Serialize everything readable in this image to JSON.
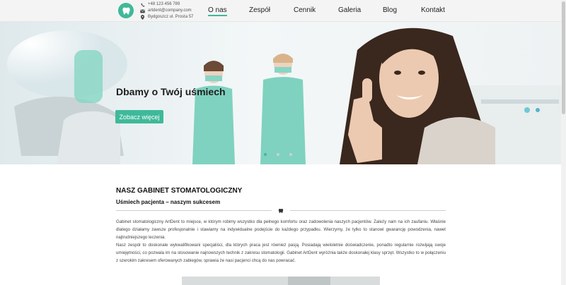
{
  "header": {
    "phone": "+48 123 456 789",
    "email": "artdent@company.com",
    "address": "Bydgoszcz ul. Prosta 57"
  },
  "nav": {
    "items": [
      {
        "label": "O nas"
      },
      {
        "label": "Zespół"
      },
      {
        "label": "Cennik"
      },
      {
        "label": "Galeria"
      },
      {
        "label": "Blog"
      },
      {
        "label": "Kontakt"
      }
    ],
    "active": "O nas"
  },
  "hero": {
    "title": "Dbamy o Twój uśmiech",
    "button": "Zobacz więcej",
    "slides_total": 3,
    "slide_active": 1
  },
  "about": {
    "title": "NASZ GABINET STOMATOLOGICZNY",
    "subtitle": "Uśmiech pacjenta – naszym sukcesem",
    "paragraph1": "Gabinet stomatologiczny ArtDent to miejsce, w którym robimy wszystko dla pełnego komfortu oraz zadowolenia naszych pacjentów. Zależy nam na ich zaufaniu. Właśnie dlatego działamy zawsze profesjonalnie i stawiamy na indywidualne podejście do każdego przypadku. Wierzymy, że tylko to stanowi gwarancję powodzenia, nawet najtrudniejszego leczenia.",
    "paragraph2": "Nasz zespół to doskonale wykwalifikowani specjaliści, dla których praca jest również pasją. Posiadają wieloletnie doświadczenie, ponadto regularnie rozwijają swoje umiejętności, co pozwala im na stosowanie najnowszych technik z zakresu stomatologii. Gabinet ArtDent wyróżnia także doskonałej klasy sprzęt. Wszystko to w połączeniu z szerokim zakresem oferowanych zabiegów, sprawia że nasi pacjenci chcą do nas powracać."
  },
  "colors": {
    "accent": "#3fb99a",
    "header_bg": "#f4f4f4"
  },
  "icons": [
    "tooth-logo-icon",
    "phone-icon",
    "envelope-icon",
    "map-pin-icon",
    "tooth-divider-icon"
  ]
}
